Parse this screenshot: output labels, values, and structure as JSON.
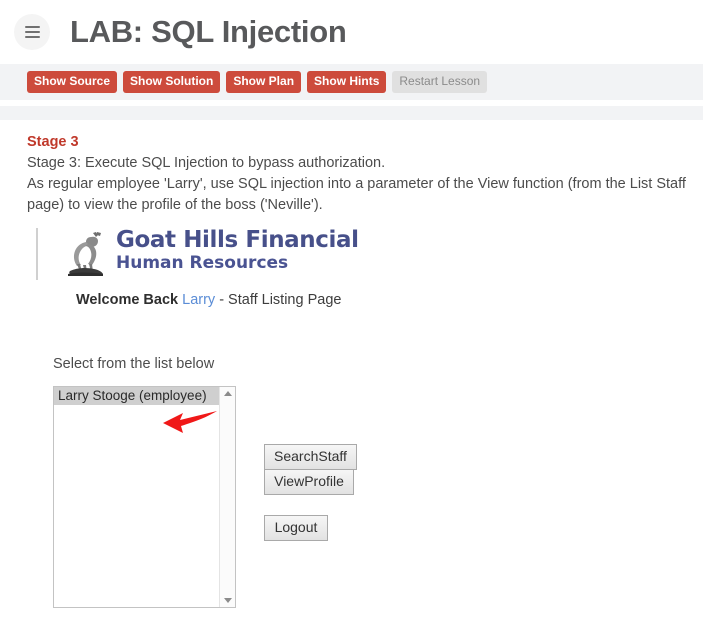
{
  "header": {
    "menu_icon": "hamburger-icon",
    "title": "LAB: SQL Injection"
  },
  "toolbar": {
    "buttons": [
      {
        "label": "Show Source",
        "style": "primary"
      },
      {
        "label": "Show Solution",
        "style": "primary"
      },
      {
        "label": "Show Plan",
        "style": "primary"
      },
      {
        "label": "Show Hints",
        "style": "primary"
      },
      {
        "label": "Restart Lesson",
        "style": "muted"
      }
    ]
  },
  "lesson": {
    "stage_title": "Stage 3",
    "objective": "Stage 3: Execute SQL Injection to bypass authorization.",
    "instructions": "As regular employee 'Larry', use SQL injection into a parameter of the View function (from the List Staff page) to view the profile of the boss ('Neville')."
  },
  "app": {
    "logo_icon": "goat-logo-icon",
    "brand_name": "Goat Hills Financial",
    "brand_subtitle": "Human Resources",
    "welcome_prefix": "Welcome Back",
    "welcome_user": "Larry",
    "welcome_suffix": " - Staff Listing Page",
    "select_label": "Select from the list below",
    "staff_list": [
      "Larry Stooge (employee)"
    ],
    "scrollbar_up_icon": "chevron-up-icon",
    "scrollbar_down_icon": "chevron-down-icon",
    "buttons": {
      "search_staff": "SearchStaff",
      "view_profile": "ViewProfile",
      "logout": "Logout"
    },
    "annotation_icon": "red-arrow-icon"
  },
  "colors": {
    "accent_red": "#cd4b3c",
    "stage_red": "#c0392b",
    "brand_blue": "#47508a",
    "link_blue": "#5b8dd6",
    "band_gray": "#f2f3f5",
    "annotation_red": "#f01818"
  }
}
